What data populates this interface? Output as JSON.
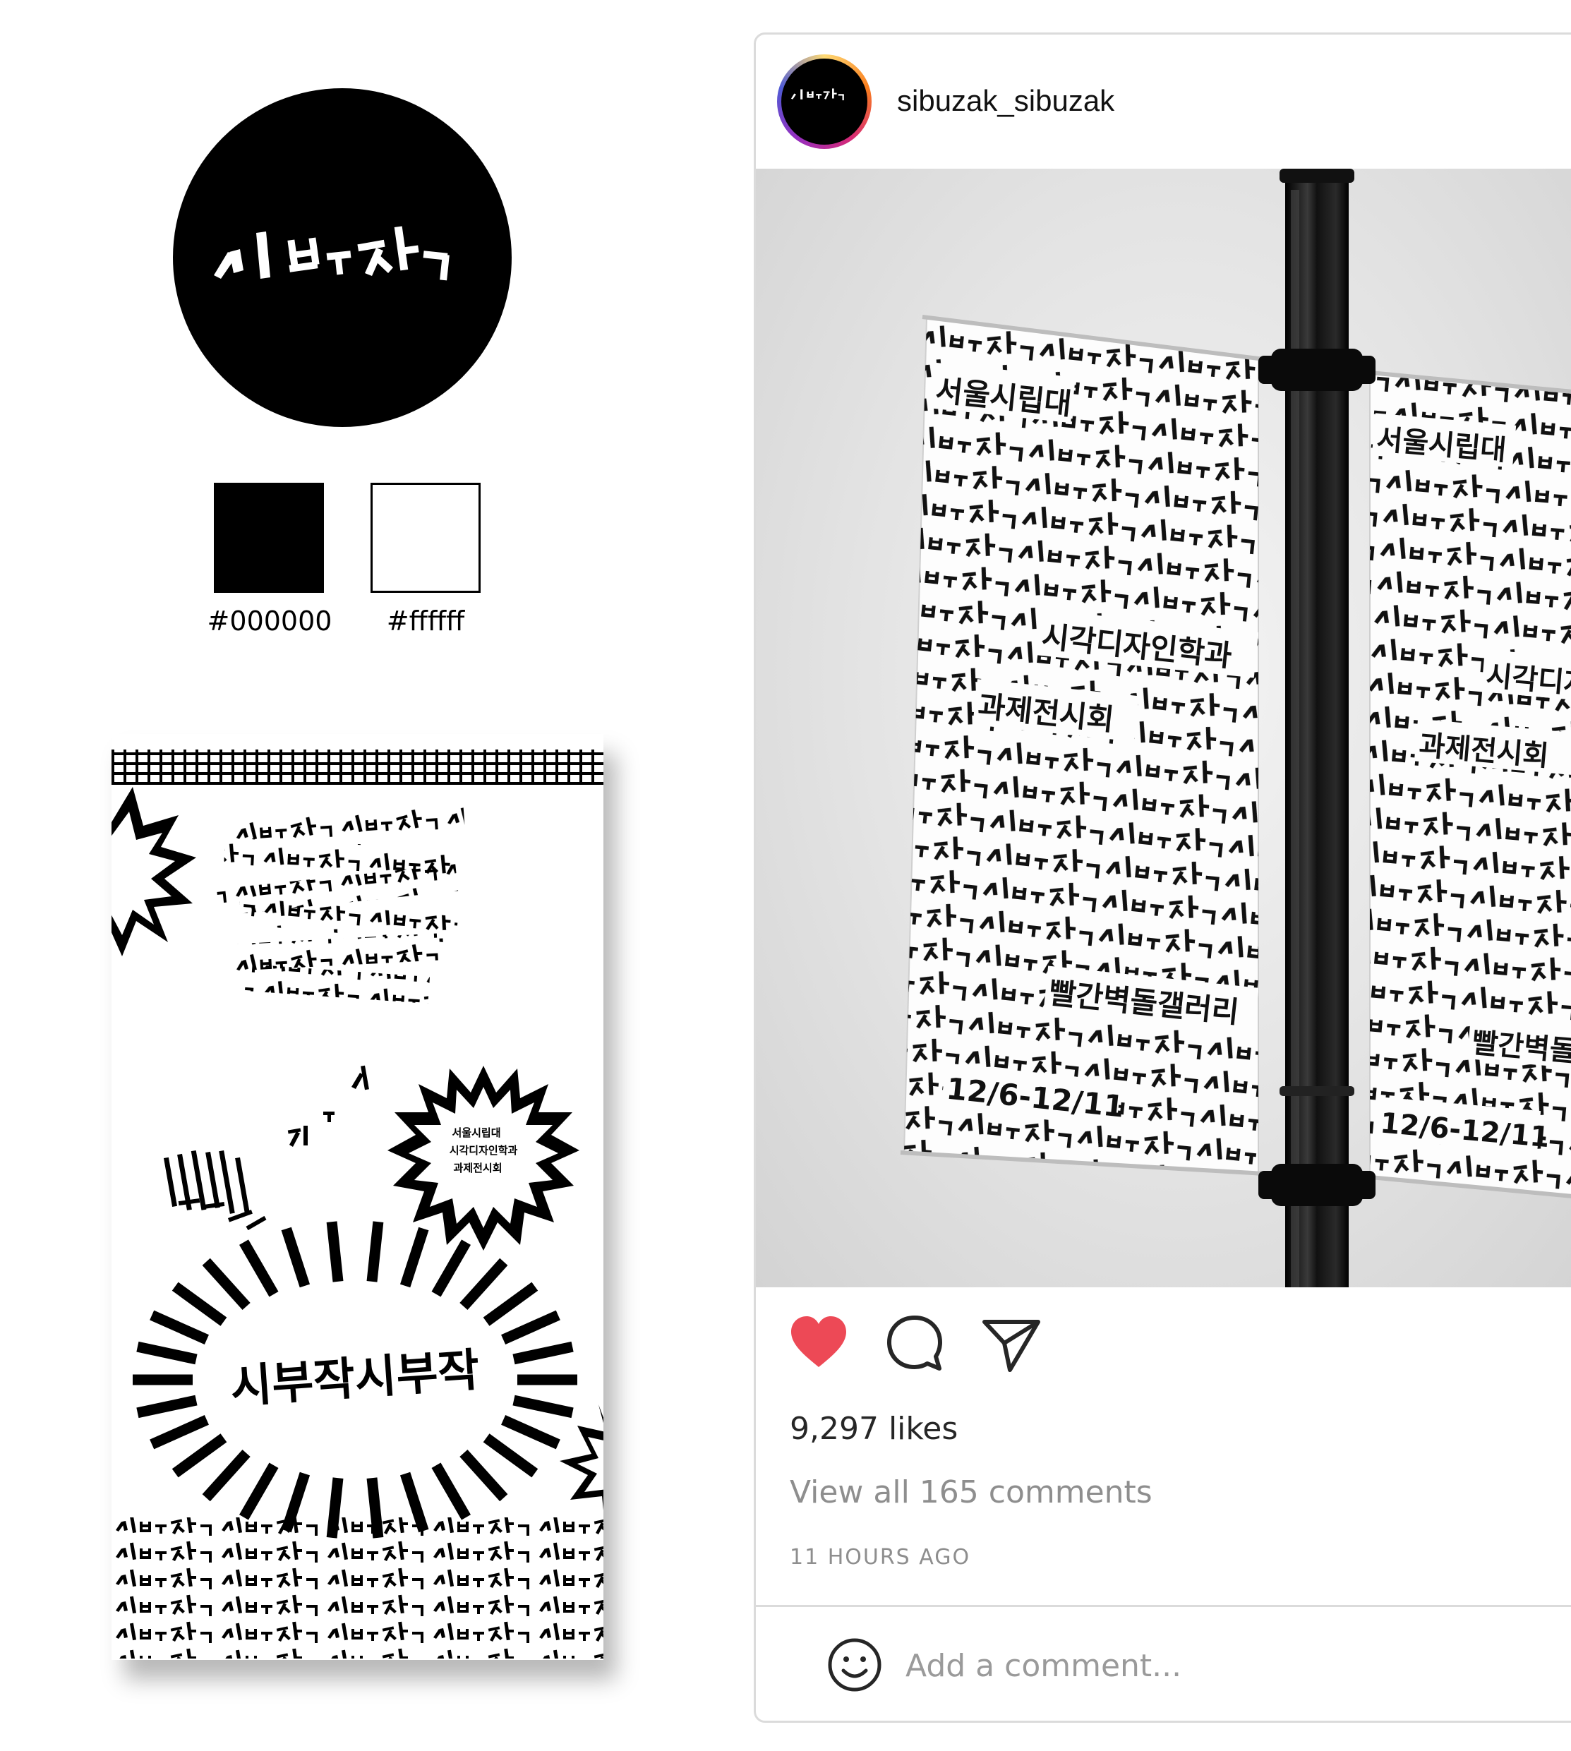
{
  "brand": {
    "logo_text": "시부작",
    "palette": [
      {
        "hex": "#000000",
        "label": "#000000"
      },
      {
        "hex": "#ffffff",
        "label": "#ffffff"
      }
    ]
  },
  "poster": {
    "headline": "시부작시부작",
    "bubble_lines": [
      "서울시립대",
      "시각디자인학과",
      "과제전시회"
    ],
    "pattern_text": "시부작"
  },
  "post": {
    "username": "sibuzak_sibuzak",
    "banner": {
      "lines": [
        "서울시립대",
        "시각디자인학과",
        "과제전시회",
        "빨간벽돌갤러리",
        "12/6-12/11"
      ],
      "pattern_text": "시부작"
    },
    "actions": [
      {
        "name": "like",
        "icon": "heart-icon",
        "active": true,
        "color": "#ed4956"
      },
      {
        "name": "comment",
        "icon": "comment-icon"
      },
      {
        "name": "share",
        "icon": "send-icon"
      }
    ],
    "likes_text": "9,297 likes",
    "view_comments_text": "View all 165 comments",
    "time_ago": "11 HOURS AGO",
    "comment_placeholder": "Add a comment..."
  }
}
